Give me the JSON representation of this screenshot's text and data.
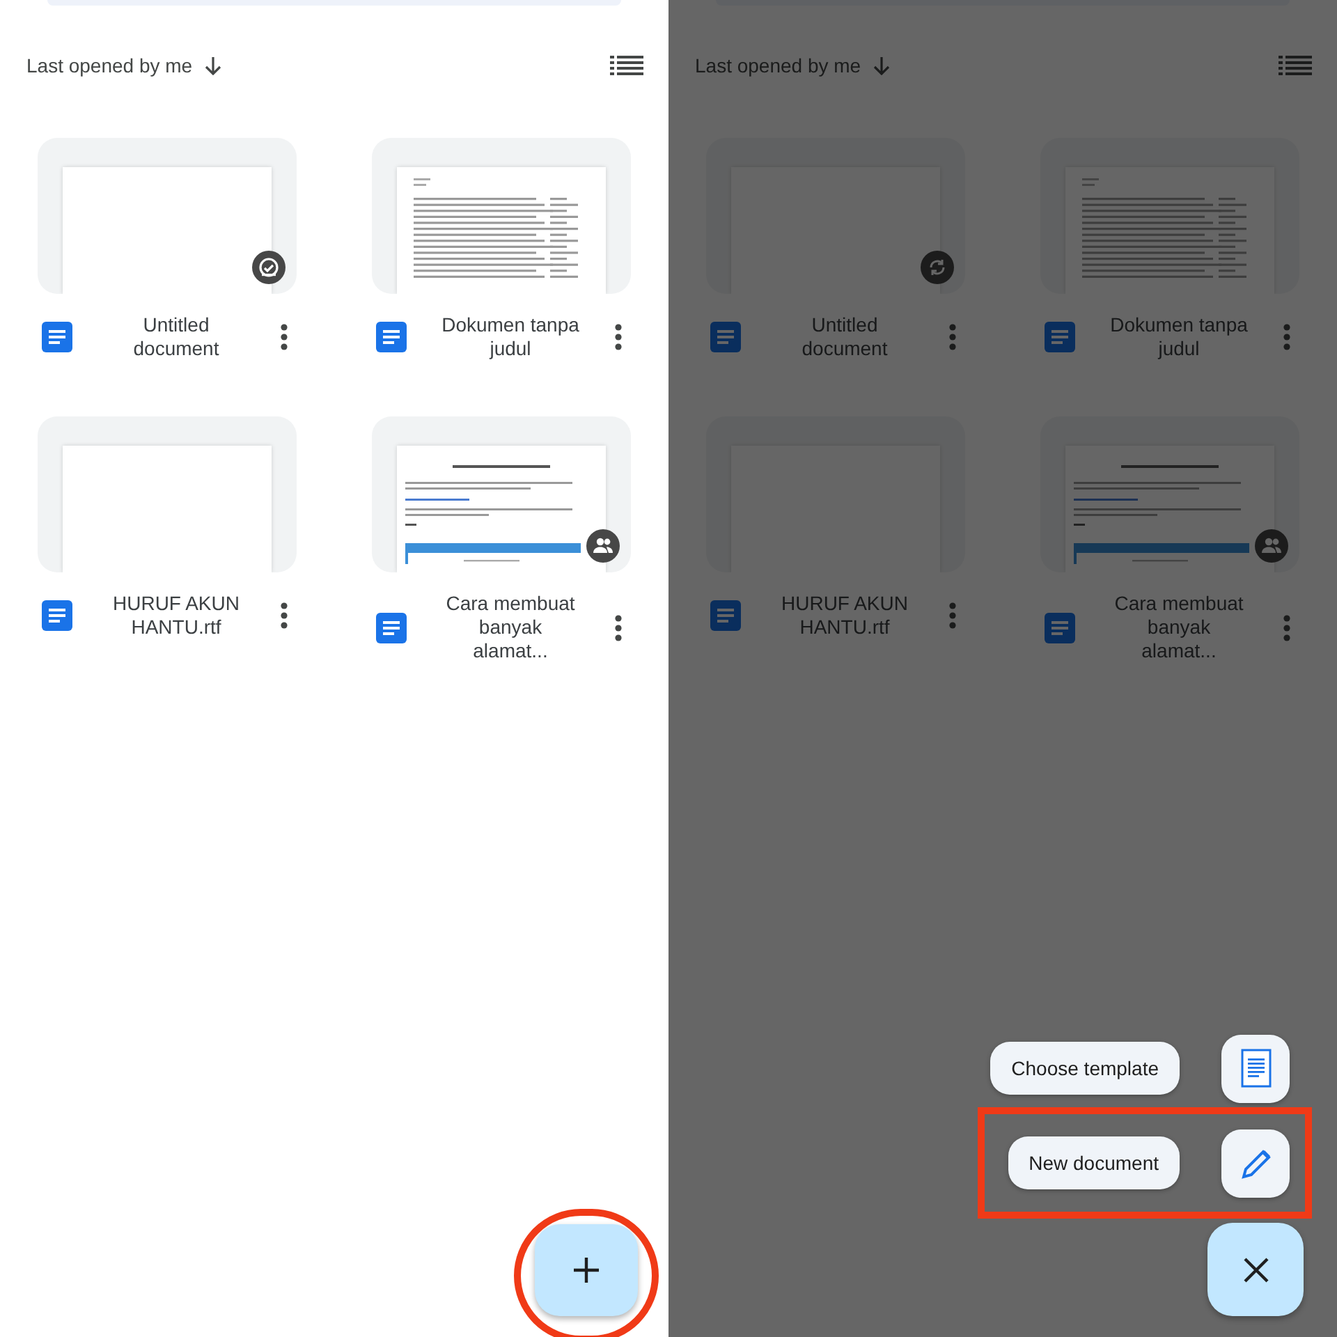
{
  "screens": [
    {
      "sort": {
        "label": "Last opened by me"
      },
      "files": [
        {
          "title": "Untitled document",
          "kind": "note",
          "badge": {
            "kind": "offline"
          }
        },
        {
          "title": "Dokumen tanpa judul",
          "kind": "table"
        },
        {
          "title": "HURUF AKUN HANTU.rtf",
          "kind": "blank"
        },
        {
          "title": "Cara membuat banyak alamat...",
          "kind": "article",
          "badge": {
            "kind": "shared"
          }
        }
      ],
      "fab": {
        "kind": "create",
        "highlighted": true
      }
    },
    {
      "sort": {
        "label": "Last opened by me"
      },
      "files": [
        {
          "title": "Untitled document",
          "kind": "note",
          "badge": {
            "kind": "sync"
          }
        },
        {
          "title": "Dokumen tanpa judul",
          "kind": "table"
        },
        {
          "title": "HURUF AKUN HANTU.rtf",
          "kind": "blank"
        },
        {
          "title": "Cara membuat banyak alamat...",
          "kind": "article",
          "badge": {
            "kind": "shared"
          }
        }
      ],
      "fab": {
        "kind": "close",
        "highlighted": false
      },
      "menu": [
        {
          "label": "Choose template",
          "kind": "template",
          "highlighted": false
        },
        {
          "label": "New document",
          "kind": "new",
          "highlighted": true
        }
      ]
    }
  ]
}
